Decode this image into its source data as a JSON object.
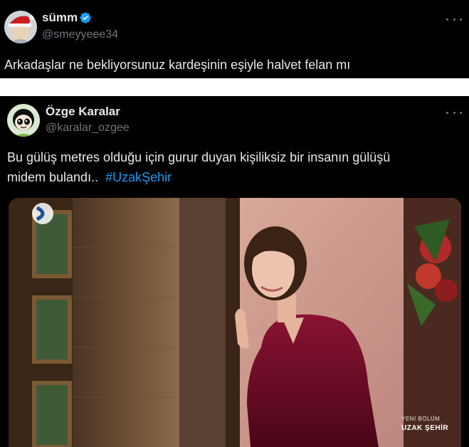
{
  "tweet1": {
    "display_name": "sümm",
    "handle": "@smeyyeee34",
    "verified": true,
    "more_icon": "more-dots-icon",
    "text": "Arkadaşlar ne bekliyorsunuz kardeşinin eşiyle halvet felan mı"
  },
  "tweet2": {
    "display_name": "Özge Karalar",
    "handle": "@karalar_ozgee",
    "more_icon": "more-dots-icon",
    "text_line1": "Bu gülüş metres olduğu için gurur duyan kişiliksiz bir insanın gülüşü",
    "text_line2": "midem bulandı..",
    "hashtag": "#UzakŞehir",
    "media": {
      "overlay_small": "YENİ BÖLÜM",
      "overlay_title": "UZAK ŞEHİR"
    }
  },
  "colors": {
    "background": "#000000",
    "text": "#e7e9ea",
    "secondary": "#71767b",
    "link": "#1d9bf0",
    "verified": "#1d9bf0"
  }
}
